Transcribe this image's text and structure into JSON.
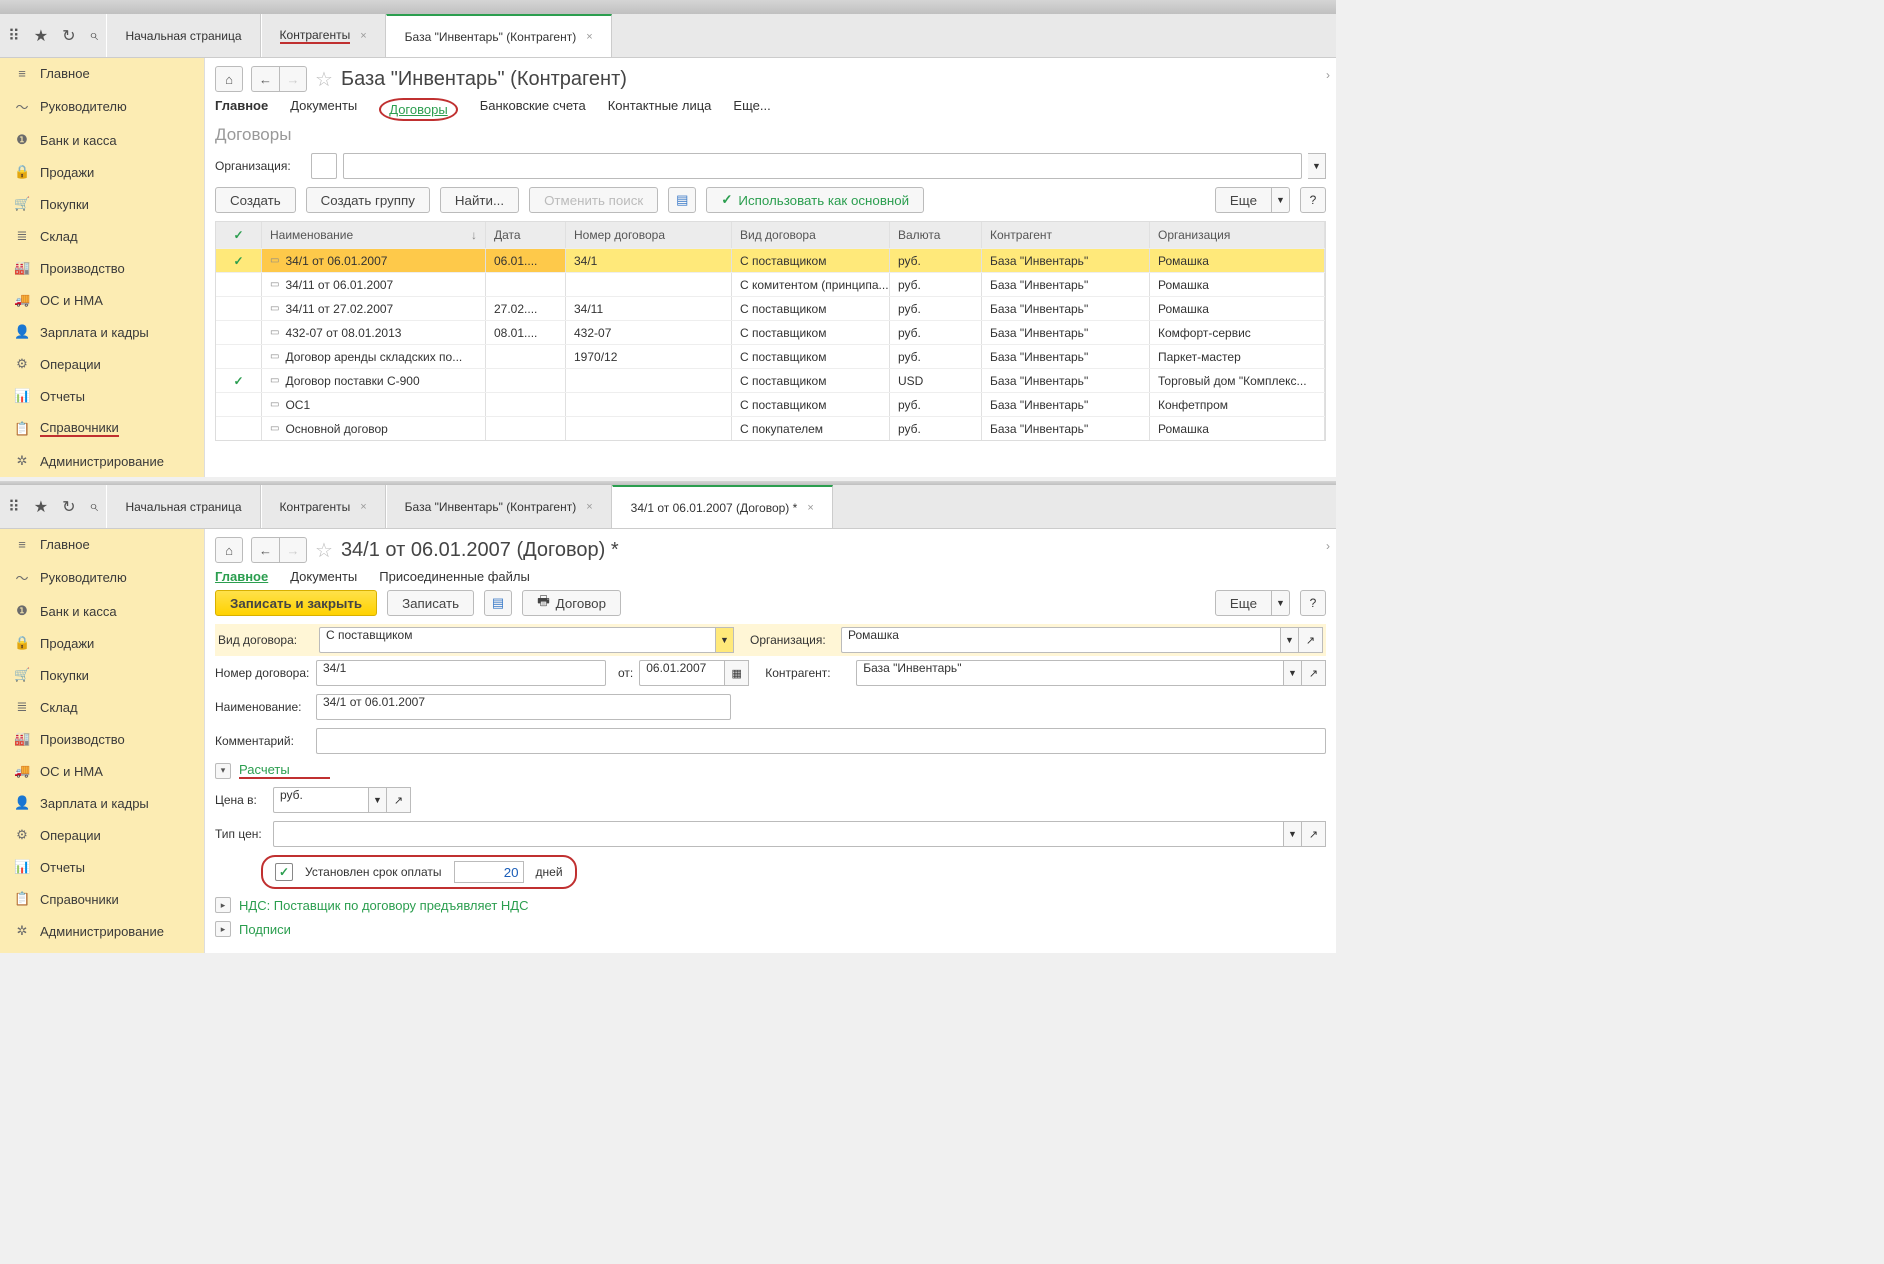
{
  "top": {
    "tabs": [
      "Начальная страница",
      "Контрагенты",
      "База \"Инвентарь\" (Контрагент)"
    ],
    "tabs2": [
      "Начальная страница",
      "Контрагенты",
      "База \"Инвентарь\" (Контрагент)",
      "34/1 от 06.01.2007 (Договор) *"
    ]
  },
  "sidebar": {
    "items": [
      {
        "icon": "≡",
        "label": "Главное"
      },
      {
        "icon": "〜",
        "label": "Руководителю"
      },
      {
        "icon": "❶",
        "label": "Банк и касса"
      },
      {
        "icon": "🔒",
        "label": "Продажи"
      },
      {
        "icon": "🛒",
        "label": "Покупки"
      },
      {
        "icon": "≣",
        "label": "Склад"
      },
      {
        "icon": "🏭",
        "label": "Производство"
      },
      {
        "icon": "🚚",
        "label": "ОС и НМА"
      },
      {
        "icon": "👤",
        "label": "Зарплата и кадры"
      },
      {
        "icon": "⚙",
        "label": "Операции"
      },
      {
        "icon": "📊",
        "label": "Отчеты"
      },
      {
        "icon": "📋",
        "label": "Справочники"
      },
      {
        "icon": "✲",
        "label": "Администрирование"
      }
    ]
  },
  "page1": {
    "title": "База \"Инвентарь\" (Контрагент)",
    "subtabs": [
      "Главное",
      "Документы",
      "Договоры",
      "Банковские счета",
      "Контактные лица",
      "Еще..."
    ],
    "section": "Договоры",
    "orgLabel": "Организация:",
    "btns": {
      "create": "Создать",
      "createGroup": "Создать группу",
      "find": "Найти...",
      "cancelSearch": "Отменить поиск",
      "useDefault": "Использовать как основной",
      "more": "Еще"
    },
    "columns": [
      "",
      "Наименование",
      "Дата",
      "Номер договора",
      "Вид договора",
      "Валюта",
      "Контрагент",
      "Организация"
    ],
    "rows": [
      {
        "chk": true,
        "name": "34/1 от 06.01.2007",
        "date": "06.01....",
        "num": "34/1",
        "type": "С поставщиком",
        "curr": "руб.",
        "agent": "База \"Инвентарь\"",
        "org": "Ромашка",
        "sel": true
      },
      {
        "chk": false,
        "name": "34/11 от 06.01.2007",
        "date": "",
        "num": "",
        "type": "С комитентом (принципа...",
        "curr": "руб.",
        "agent": "База \"Инвентарь\"",
        "org": "Ромашка"
      },
      {
        "chk": false,
        "name": "34/11 от 27.02.2007",
        "date": "27.02....",
        "num": "34/11",
        "type": "С поставщиком",
        "curr": "руб.",
        "agent": "База \"Инвентарь\"",
        "org": "Ромашка"
      },
      {
        "chk": false,
        "name": "432-07 от 08.01.2013",
        "date": "08.01....",
        "num": "432-07",
        "type": "С поставщиком",
        "curr": "руб.",
        "agent": "База \"Инвентарь\"",
        "org": "Комфорт-сервис"
      },
      {
        "chk": false,
        "name": "Договор аренды складских по...",
        "date": "",
        "num": "1970/12",
        "type": "С поставщиком",
        "curr": "руб.",
        "agent": "База \"Инвентарь\"",
        "org": "Паркет-мастер"
      },
      {
        "chk": true,
        "name": "Договор поставки С-900",
        "date": "",
        "num": "",
        "type": "С поставщиком",
        "curr": "USD",
        "agent": "База \"Инвентарь\"",
        "org": "Торговый дом \"Комплекс..."
      },
      {
        "chk": false,
        "name": "ОС1",
        "date": "",
        "num": "",
        "type": "С поставщиком",
        "curr": "руб.",
        "agent": "База \"Инвентарь\"",
        "org": "Конфетпром"
      },
      {
        "chk": false,
        "name": "Основной договор",
        "date": "",
        "num": "",
        "type": "С покупателем",
        "curr": "руб.",
        "agent": "База \"Инвентарь\"",
        "org": "Ромашка"
      }
    ]
  },
  "page2": {
    "title": "34/1 от 06.01.2007 (Договор) *",
    "subtabs": [
      "Главное",
      "Документы",
      "Присоединенные файлы"
    ],
    "btns": {
      "saveClose": "Записать и закрыть",
      "save": "Записать",
      "contract": "Договор",
      "more": "Еще"
    },
    "fields": {
      "typeLabel": "Вид договора:",
      "typeValue": "С поставщиком",
      "orgLabel": "Организация:",
      "orgValue": "Ромашка",
      "numLabel": "Номер договора:",
      "numValue": "34/1",
      "fromLabel": "от:",
      "fromValue": "06.01.2007",
      "agentLabel": "Контрагент:",
      "agentValue": "База \"Инвентарь\"",
      "nameLabel": "Наименование:",
      "nameValue": "34/1 от 06.01.2007",
      "commentLabel": "Комментарий:",
      "commentValue": "",
      "calcSection": "Расчеты",
      "priceLabel": "Цена в:",
      "priceValue": "руб.",
      "priceTypeLabel": "Тип цен:",
      "priceTypeValue": "",
      "dueLabel": "Установлен срок оплаты",
      "dueValue": "20",
      "daysLabel": "дней",
      "vatSection": "НДС: Поставщик по договору предъявляет НДС",
      "signSection": "Подписи"
    }
  }
}
